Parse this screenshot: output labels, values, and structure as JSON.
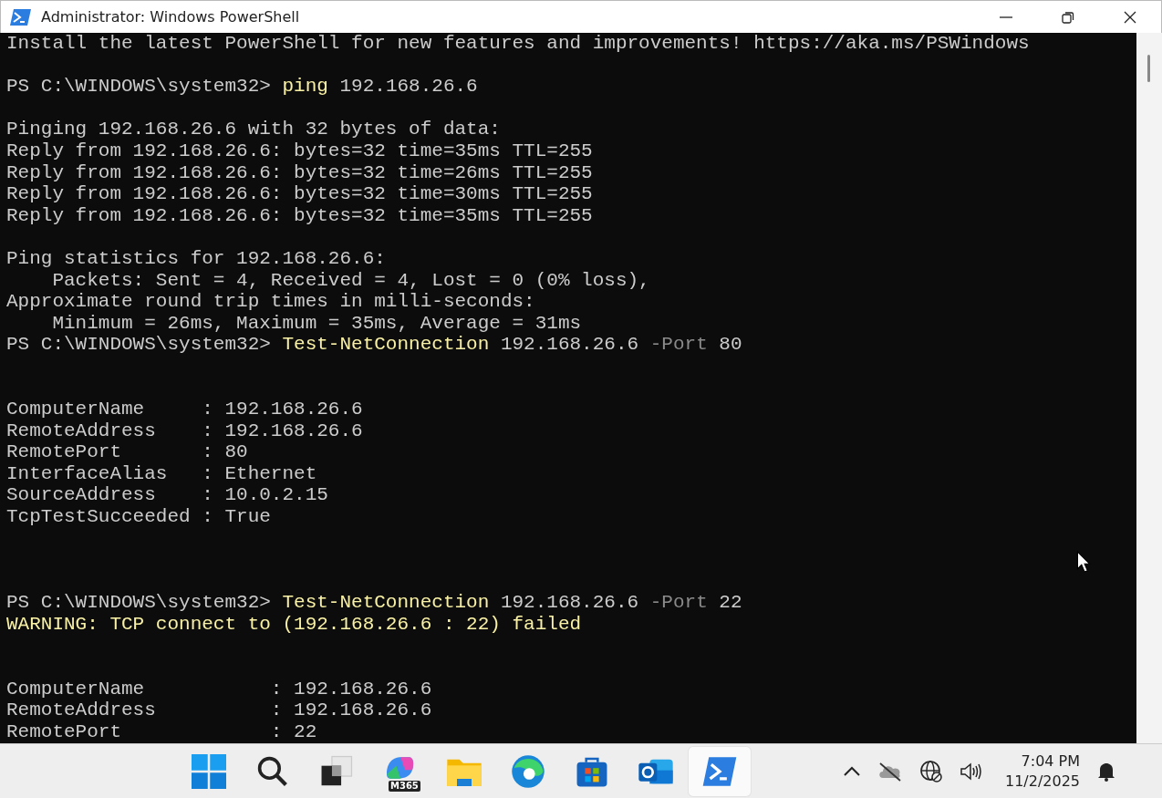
{
  "window": {
    "title": "Administrator: Windows PowerShell"
  },
  "terminal": {
    "lines": [
      {
        "kind": "text",
        "segments": [
          {
            "kind": "plain",
            "text": "Install the latest PowerShell for new features and improvements! https://aka.ms/PSWindows"
          }
        ]
      },
      {
        "kind": "blank"
      },
      {
        "kind": "text",
        "segments": [
          {
            "kind": "plain",
            "text": "PS C:\\WINDOWS\\system32> "
          },
          {
            "kind": "command",
            "text": "ping"
          },
          {
            "kind": "plain",
            "text": " 192.168.26.6"
          }
        ]
      },
      {
        "kind": "blank"
      },
      {
        "kind": "text",
        "segments": [
          {
            "kind": "plain",
            "text": "Pinging 192.168.26.6 with 32 bytes of data:"
          }
        ]
      },
      {
        "kind": "text",
        "segments": [
          {
            "kind": "plain",
            "text": "Reply from 192.168.26.6: bytes=32 time=35ms TTL=255"
          }
        ]
      },
      {
        "kind": "text",
        "segments": [
          {
            "kind": "plain",
            "text": "Reply from 192.168.26.6: bytes=32 time=26ms TTL=255"
          }
        ]
      },
      {
        "kind": "text",
        "segments": [
          {
            "kind": "plain",
            "text": "Reply from 192.168.26.6: bytes=32 time=30ms TTL=255"
          }
        ]
      },
      {
        "kind": "text",
        "segments": [
          {
            "kind": "plain",
            "text": "Reply from 192.168.26.6: bytes=32 time=35ms TTL=255"
          }
        ]
      },
      {
        "kind": "blank"
      },
      {
        "kind": "text",
        "segments": [
          {
            "kind": "plain",
            "text": "Ping statistics for 192.168.26.6:"
          }
        ]
      },
      {
        "kind": "text",
        "segments": [
          {
            "kind": "plain",
            "text": "    Packets: Sent = 4, Received = 4, Lost = 0 (0% loss),"
          }
        ]
      },
      {
        "kind": "text",
        "segments": [
          {
            "kind": "plain",
            "text": "Approximate round trip times in milli-seconds:"
          }
        ]
      },
      {
        "kind": "text",
        "segments": [
          {
            "kind": "plain",
            "text": "    Minimum = 26ms, Maximum = 35ms, Average = 31ms"
          }
        ]
      },
      {
        "kind": "text",
        "segments": [
          {
            "kind": "plain",
            "text": "PS C:\\WINDOWS\\system32> "
          },
          {
            "kind": "command",
            "text": "Test-NetConnection"
          },
          {
            "kind": "plain",
            "text": " 192.168.26.6 "
          },
          {
            "kind": "param",
            "text": "-Port"
          },
          {
            "kind": "plain",
            "text": " 80"
          }
        ]
      },
      {
        "kind": "blank"
      },
      {
        "kind": "blank"
      },
      {
        "kind": "text",
        "segments": [
          {
            "kind": "plain",
            "text": "ComputerName     : 192.168.26.6"
          }
        ]
      },
      {
        "kind": "text",
        "segments": [
          {
            "kind": "plain",
            "text": "RemoteAddress    : 192.168.26.6"
          }
        ]
      },
      {
        "kind": "text",
        "segments": [
          {
            "kind": "plain",
            "text": "RemotePort       : 80"
          }
        ]
      },
      {
        "kind": "text",
        "segments": [
          {
            "kind": "plain",
            "text": "InterfaceAlias   : Ethernet"
          }
        ]
      },
      {
        "kind": "text",
        "segments": [
          {
            "kind": "plain",
            "text": "SourceAddress    : 10.0.2.15"
          }
        ]
      },
      {
        "kind": "text",
        "segments": [
          {
            "kind": "plain",
            "text": "TcpTestSucceeded : True"
          }
        ]
      },
      {
        "kind": "blank"
      },
      {
        "kind": "blank"
      },
      {
        "kind": "blank"
      },
      {
        "kind": "text",
        "segments": [
          {
            "kind": "plain",
            "text": "PS C:\\WINDOWS\\system32> "
          },
          {
            "kind": "command",
            "text": "Test-NetConnection"
          },
          {
            "kind": "plain",
            "text": " 192.168.26.6 "
          },
          {
            "kind": "param",
            "text": "-Port"
          },
          {
            "kind": "plain",
            "text": " 22"
          }
        ]
      },
      {
        "kind": "text",
        "segments": [
          {
            "kind": "warning",
            "text": "WARNING: TCP connect to (192.168.26.6 : 22) failed"
          }
        ]
      },
      {
        "kind": "blank"
      },
      {
        "kind": "blank"
      },
      {
        "kind": "text",
        "segments": [
          {
            "kind": "plain",
            "text": "ComputerName           : 192.168.26.6"
          }
        ]
      },
      {
        "kind": "text",
        "segments": [
          {
            "kind": "plain",
            "text": "RemoteAddress          : 192.168.26.6"
          }
        ]
      },
      {
        "kind": "text",
        "segments": [
          {
            "kind": "plain",
            "text": "RemotePort             : 22"
          }
        ]
      }
    ]
  },
  "taskbar": {
    "apps": [
      {
        "kind": "start",
        "selected": false
      },
      {
        "kind": "search",
        "selected": false
      },
      {
        "kind": "taskview",
        "selected": false
      },
      {
        "kind": "copilot",
        "selected": false,
        "badge": "M365"
      },
      {
        "kind": "files",
        "selected": false
      },
      {
        "kind": "browser",
        "selected": false
      },
      {
        "kind": "store",
        "selected": false
      },
      {
        "kind": "mail",
        "selected": false
      },
      {
        "kind": "powershell",
        "selected": true
      }
    ],
    "tray": {
      "time": "7:04 PM",
      "date": "11/2/2025"
    }
  }
}
